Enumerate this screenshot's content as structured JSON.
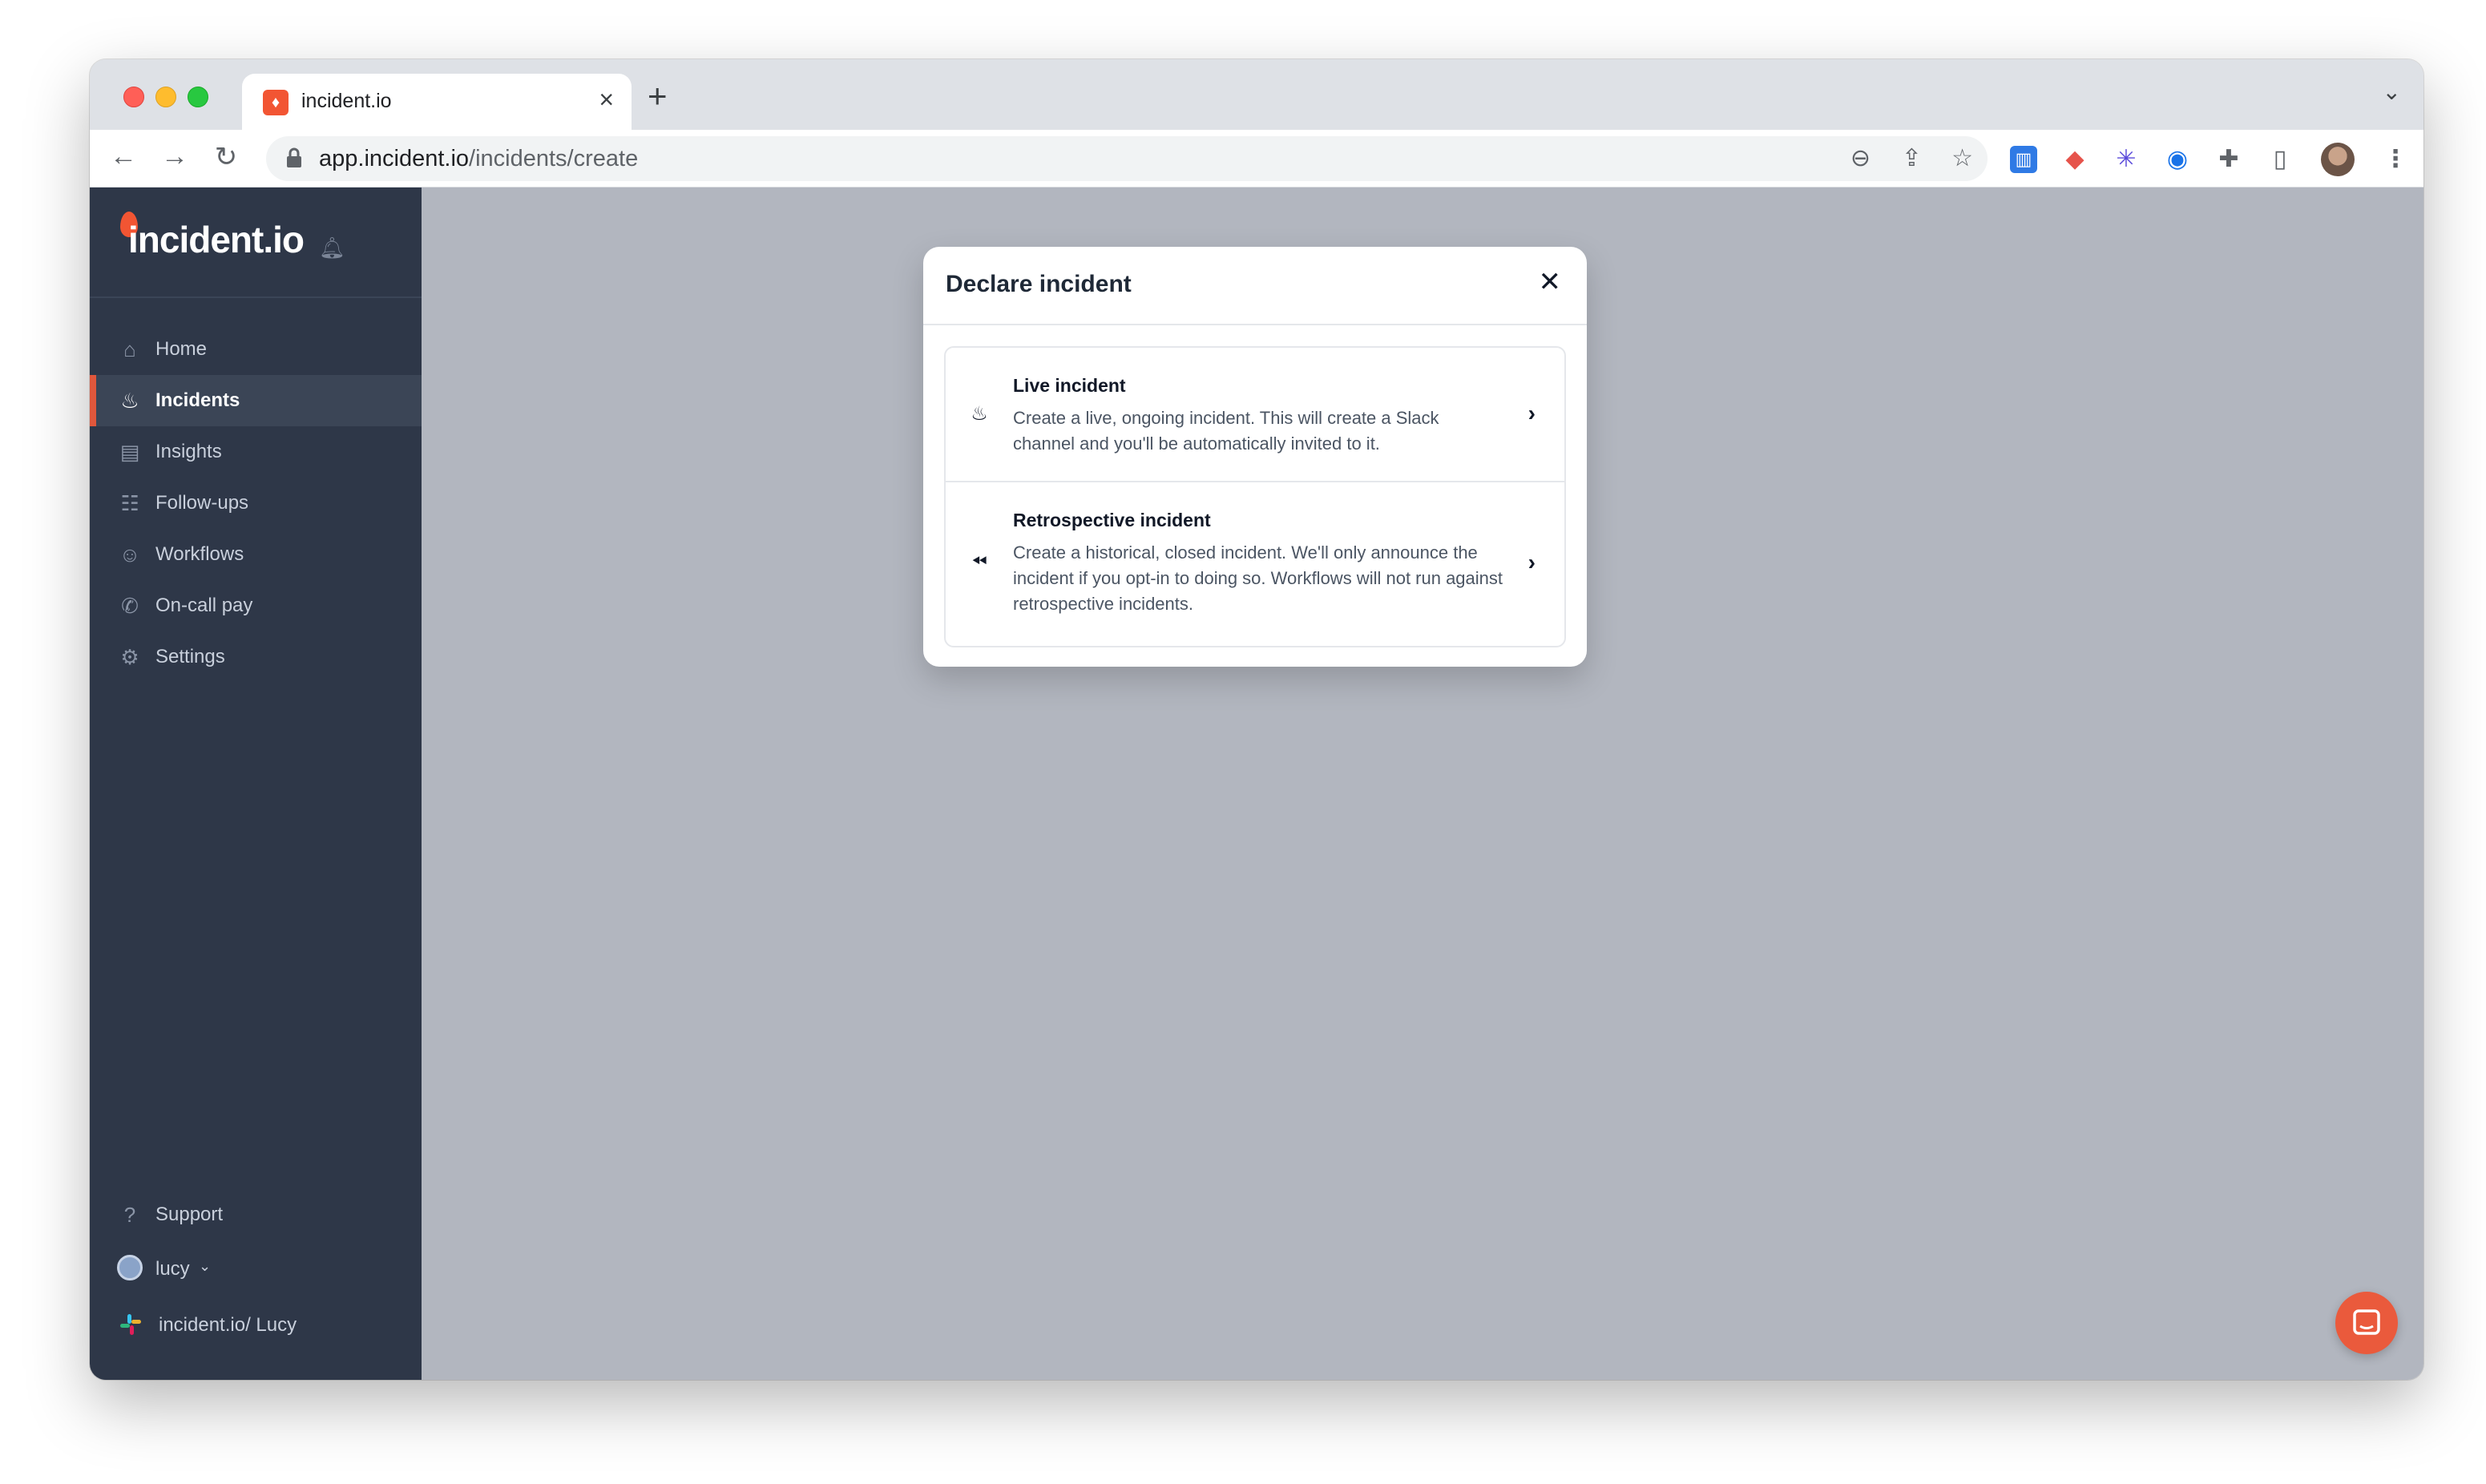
{
  "browser": {
    "tab_title": "incident.io",
    "url_host": "app.incident.io",
    "url_path": "/incidents/create",
    "favicon": "incident-flame-icon"
  },
  "sidebar": {
    "logo_text": "incident.io",
    "items": [
      {
        "label": "Home",
        "icon": "home-icon"
      },
      {
        "label": "Incidents",
        "icon": "flame-icon",
        "active": true
      },
      {
        "label": "Insights",
        "icon": "chart-icon"
      },
      {
        "label": "Follow-ups",
        "icon": "checklist-icon"
      },
      {
        "label": "Workflows",
        "icon": "robot-icon"
      },
      {
        "label": "On-call pay",
        "icon": "phone-icon"
      },
      {
        "label": "Settings",
        "icon": "gear-icon"
      }
    ],
    "support_label": "Support",
    "user_label": "lucy",
    "workspace_label": "incident.io/ Lucy"
  },
  "modal": {
    "title": "Declare incident",
    "options": [
      {
        "title": "Live incident",
        "description": "Create a live, ongoing incident. This will create a Slack channel and you'll be automatically invited to it."
      },
      {
        "title": "Retrospective incident",
        "description": "Create a historical, closed incident. We'll only announce the incident if you opt-in to doing so. Workflows will not run against retrospective incidents."
      }
    ]
  },
  "colors": {
    "brand": "#f25533",
    "sidebar_bg": "#2e3748",
    "overlay_bg": "#b2b6bf"
  }
}
